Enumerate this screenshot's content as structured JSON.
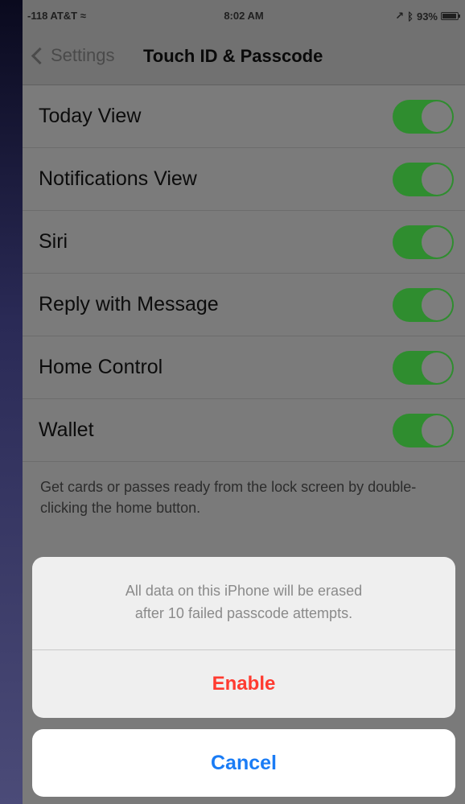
{
  "status_bar": {
    "carrier": "-118 AT&T ≈",
    "time": "8:02 AM",
    "battery": "93%"
  },
  "nav": {
    "back_label": "Settings",
    "title": "Touch ID & Passcode"
  },
  "rows": [
    {
      "label": "Today View",
      "enabled": true
    },
    {
      "label": "Notifications View",
      "enabled": true
    },
    {
      "label": "Siri",
      "enabled": true
    },
    {
      "label": "Reply with Message",
      "enabled": true
    },
    {
      "label": "Home Control",
      "enabled": true
    },
    {
      "label": "Wallet",
      "enabled": true
    }
  ],
  "footer_note": "Get cards or passes ready from the lock screen by double-clicking the home button.",
  "action_sheet": {
    "message_line1": "All data on this iPhone will be erased",
    "message_line2": "after 10 failed passcode attempts.",
    "enable_label": "Enable",
    "cancel_label": "Cancel"
  },
  "colors": {
    "toggle_on": "#2f8d2f",
    "destructive": "#ff3b30",
    "link": "#1a7cf5"
  }
}
